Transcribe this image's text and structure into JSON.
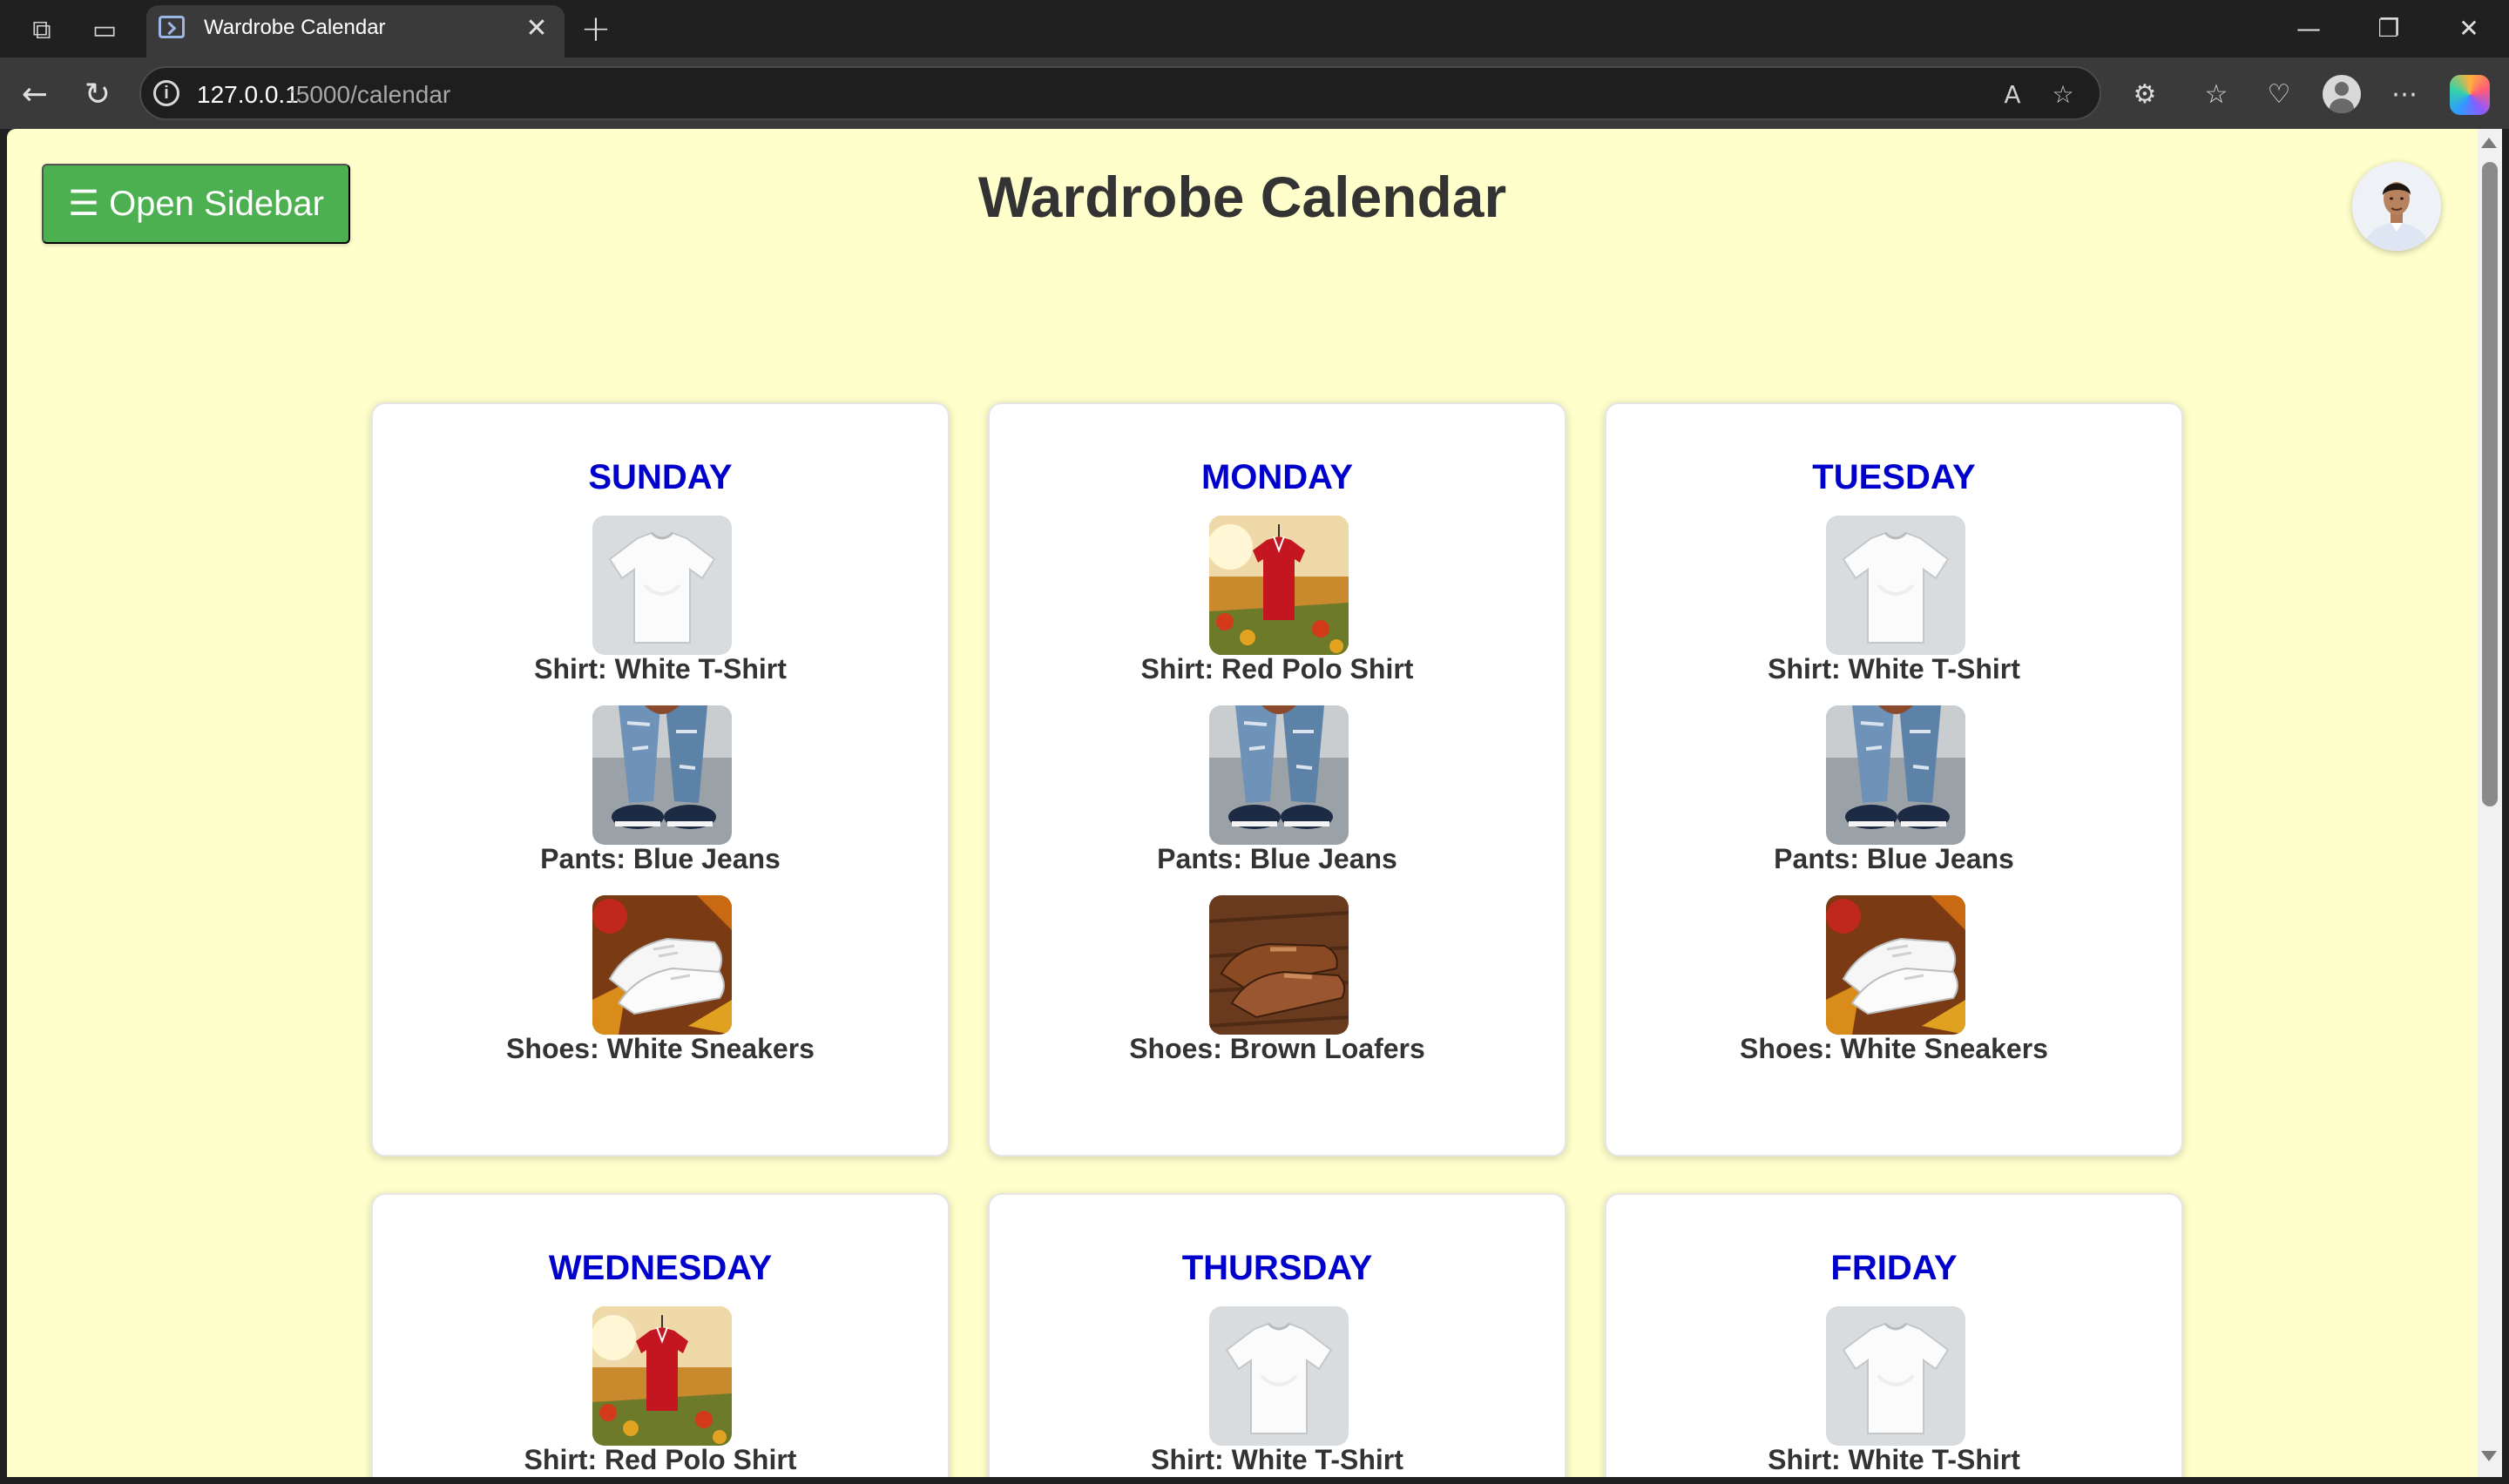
{
  "browser": {
    "tab_title": "Wardrobe Calendar",
    "url_host": "127.0.0.1",
    "url_path": ":5000/calendar"
  },
  "page": {
    "title": "Wardrobe Calendar",
    "open_sidebar_label": "☰ Open Sidebar"
  },
  "days": [
    {
      "name": "SUNDAY",
      "items": [
        {
          "label": "Shirt: White T-Shirt",
          "icon": "white-tshirt"
        },
        {
          "label": "Pants: Blue Jeans",
          "icon": "blue-jeans"
        },
        {
          "label": "Shoes: White Sneakers",
          "icon": "white-sneakers"
        }
      ]
    },
    {
      "name": "MONDAY",
      "items": [
        {
          "label": "Shirt: Red Polo Shirt",
          "icon": "red-polo"
        },
        {
          "label": "Pants: Blue Jeans",
          "icon": "blue-jeans"
        },
        {
          "label": "Shoes: Brown Loafers",
          "icon": "brown-loafers"
        }
      ]
    },
    {
      "name": "TUESDAY",
      "items": [
        {
          "label": "Shirt: White T-Shirt",
          "icon": "white-tshirt"
        },
        {
          "label": "Pants: Blue Jeans",
          "icon": "blue-jeans"
        },
        {
          "label": "Shoes: White Sneakers",
          "icon": "white-sneakers"
        }
      ]
    },
    {
      "name": "WEDNESDAY",
      "items": [
        {
          "label": "Shirt: Red Polo Shirt",
          "icon": "red-polo"
        }
      ]
    },
    {
      "name": "THURSDAY",
      "items": [
        {
          "label": "Shirt: White T-Shirt",
          "icon": "white-tshirt"
        }
      ]
    },
    {
      "name": "FRIDAY",
      "items": [
        {
          "label": "Shirt: White T-Shirt",
          "icon": "white-tshirt"
        }
      ]
    }
  ],
  "colors": {
    "page_background": "#ffffcc",
    "sidebar_button": "#4caf50",
    "day_name": "#0000cc",
    "title_text": "#333333"
  }
}
